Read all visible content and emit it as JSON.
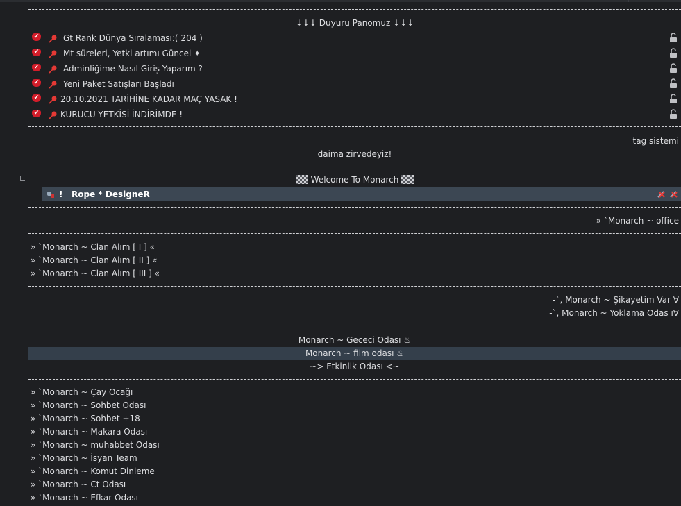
{
  "announcements": {
    "header": "↓↓↓ Duyuru Panomuz ↓↓↓",
    "items": [
      {
        "label": "Gt Rank Dünya Sıralaması:( 204 )"
      },
      {
        "label": "Mt süreleri, Yetki artımı Güncel ✦"
      },
      {
        "label": "Adminliğime Nasıl Giriş Yaparım ?"
      },
      {
        "label": "Yeni Paket Satışları Başladı"
      },
      {
        "label": "20.10.2021 TARİHİNE KADAR MAÇ YASAK !"
      },
      {
        "label": "KURUCU YETKİSİ İNDİRİMDE !"
      }
    ]
  },
  "tag_system": "tag sistemi",
  "slogan": "daima zirvedeyiz!",
  "welcome": "Welcome To Monarch",
  "user_banner": {
    "prefix": "!",
    "name": "Rope * DesigneR"
  },
  "office": "» `Monarch ~ office",
  "clan_channels": [
    "» `Monarch ~ Clan Alım [ I ] «",
    "» `Monarch ~ Clan Alım [ II ] «",
    "» `Monarch ~ Clan Alım [ III ] «"
  ],
  "complaint_channels": [
    "-`, Monarch ~ Şikayetim Var ∀",
    "-`, Monarch ~ Yoklama Odas ı∀"
  ],
  "center_channels": [
    "Monarch ~ Gececi Odası ♨",
    "Monarch ~ film odası ♨",
    "~> Etkinlik Odası <~"
  ],
  "rooms": [
    "» `Monarch ~ Çay Ocağı",
    "» `Monarch ~ Sohbet Odası",
    "» `Monarch ~ Sohbet +18",
    "» `Monarch ~ Makara Odası",
    "» `Monarch ~ muhabbet Odası",
    "» `Monarch ~ İsyan Team",
    "» `Monarch ~ Komut Dinleme",
    "» `Monarch ~ Ct Odası",
    "» `Monarch ~ Efkar Odası"
  ],
  "colors": {
    "background": "#1e1f22",
    "text": "#dcdde0",
    "banner": "#3c4753",
    "highlight": "#343f4b",
    "accent": "#d31d2a"
  }
}
